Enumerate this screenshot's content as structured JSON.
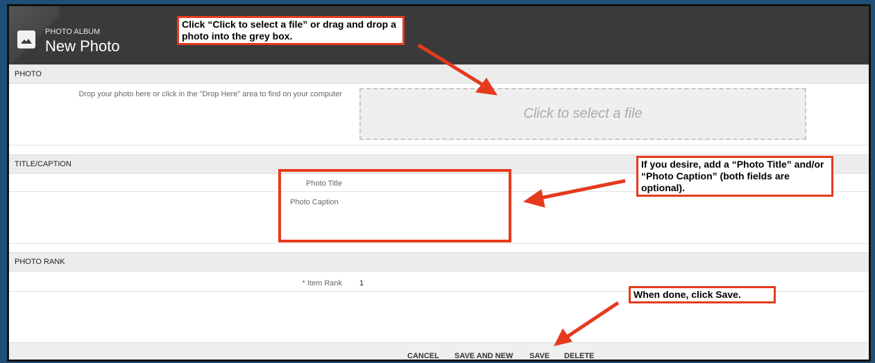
{
  "header": {
    "breadcrumb": "PHOTO ALBUM",
    "title": "New Photo",
    "icon": "image-icon"
  },
  "sections": {
    "photo": "PHOTO",
    "title_caption": "TITLE/CAPTION",
    "photo_rank": "PHOTO RANK"
  },
  "photo": {
    "instructions": "Drop your photo here or click in the \"Drop Here\" area to find on your computer",
    "dropzone_label": "Click to select a file"
  },
  "title_caption": {
    "title_label": "Photo Title",
    "caption_label": "Photo Caption"
  },
  "rank": {
    "label": "* Item Rank",
    "value": "1"
  },
  "footer": {
    "cancel": "CANCEL",
    "save_and_new": "SAVE AND NEW",
    "save": "SAVE",
    "delete": "DELETE"
  },
  "callouts": {
    "select_file": "Click “Click to select a file” or drag and drop a photo into the grey box.",
    "optional_fields": "If you desire, add a “Photo Title” and/or “Photo Caption” (both fields are optional).",
    "save": "When done, click Save."
  },
  "colors": {
    "annotation": "#e53a1e",
    "header": "#3a3a3a",
    "background": "#1f4e79"
  }
}
